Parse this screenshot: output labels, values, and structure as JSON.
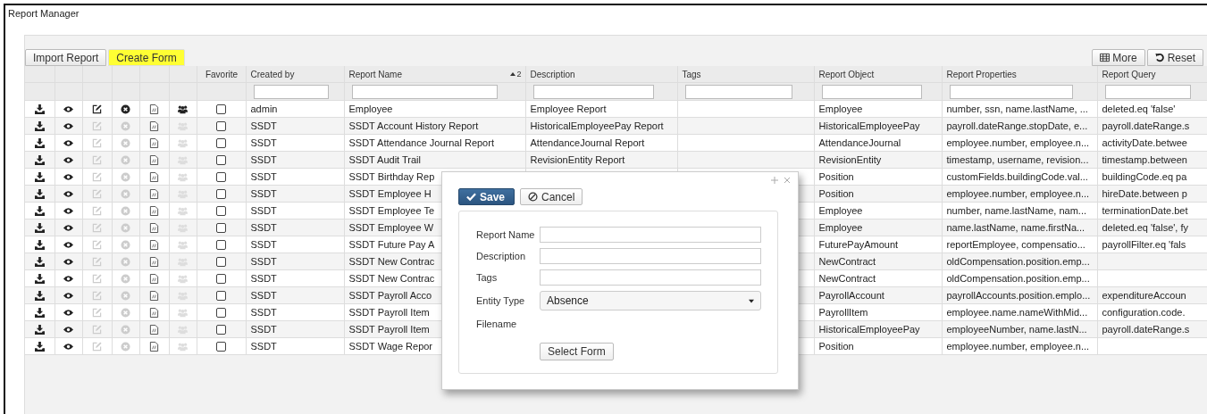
{
  "window": {
    "title": "Report Manager"
  },
  "toolbar": {
    "buttons": [
      {
        "label": "Import Report",
        "highlighted": false
      },
      {
        "label": "Create Form",
        "highlighted": true
      }
    ],
    "right_buttons": [
      {
        "label": "More",
        "kind": "grid"
      },
      {
        "label": "Reset",
        "kind": "undo"
      }
    ]
  },
  "columns": [
    {
      "label": "Favorite",
      "filter": false
    },
    {
      "label": "Created by",
      "filter": true
    },
    {
      "label": "Report Name",
      "filter": true,
      "sort_order": "2"
    },
    {
      "label": "Description",
      "filter": true
    },
    {
      "label": "Tags",
      "filter": true
    },
    {
      "label": "Report Object",
      "filter": true
    },
    {
      "label": "Report Properties",
      "filter": true
    },
    {
      "label": "Report Query",
      "filter": true
    }
  ],
  "rows": [
    {
      "editable": true,
      "favorite": false,
      "created_by": "admin",
      "report_name": "Employee",
      "description": "Employee Report",
      "report_object": "Employee",
      "report_properties": "number, ssn, name.lastName, ...",
      "report_query": "deleted.eq 'false'"
    },
    {
      "editable": false,
      "favorite": false,
      "created_by": "SSDT",
      "report_name": "SSDT Account History Report",
      "description": "HistoricalEmployeePay Report",
      "report_object": "HistoricalEmployeePay",
      "report_properties": "payroll.dateRange.stopDate, e...",
      "report_query": "payroll.dateRange.s"
    },
    {
      "editable": false,
      "favorite": false,
      "created_by": "SSDT",
      "report_name": "SSDT Attendance Journal Report",
      "description": "AttendanceJournal Report",
      "report_object": "AttendanceJournal",
      "report_properties": "employee.number, employee.n...",
      "report_query": "activityDate.betwee"
    },
    {
      "editable": false,
      "favorite": false,
      "created_by": "SSDT",
      "report_name": "SSDT Audit Trail",
      "description": "RevisionEntity Report",
      "report_object": "RevisionEntity",
      "report_properties": "timestamp, username, revision...",
      "report_query": "timestamp.between"
    },
    {
      "editable": false,
      "favorite": false,
      "created_by": "SSDT",
      "report_name": "SSDT Birthday Rep",
      "report_object": "Position",
      "report_properties": "customFields.buildingCode.val...",
      "report_query": "buildingCode.eq pa"
    },
    {
      "editable": false,
      "favorite": false,
      "created_by": "SSDT",
      "report_name": "SSDT Employee H",
      "report_object": "Position",
      "report_properties": "employee.number, employee.n...",
      "report_query": "hireDate.between p"
    },
    {
      "editable": false,
      "favorite": false,
      "created_by": "SSDT",
      "report_name": "SSDT Employee Te",
      "report_object": "Employee",
      "report_properties": "number, name.lastName, nam...",
      "report_query": "terminationDate.bet"
    },
    {
      "editable": false,
      "favorite": false,
      "created_by": "SSDT",
      "report_name": "SSDT Employee W",
      "report_object": "Employee",
      "report_properties": "name.lastName, name.firstNa...",
      "report_query": "deleted.eq 'false', fy"
    },
    {
      "editable": false,
      "favorite": false,
      "created_by": "SSDT",
      "report_name": "SSDT Future Pay A",
      "report_object": "FuturePayAmount",
      "report_properties": "reportEmployee, compensatio...",
      "report_query": "payrollFilter.eq 'fals"
    },
    {
      "editable": false,
      "favorite": false,
      "created_by": "SSDT",
      "report_name": "SSDT New Contrac",
      "report_object": "NewContract",
      "report_properties": "oldCompensation.position.emp..."
    },
    {
      "editable": false,
      "favorite": false,
      "created_by": "SSDT",
      "report_name": "SSDT New Contrac",
      "report_object": "NewContract",
      "report_properties": "oldCompensation.position.emp..."
    },
    {
      "editable": false,
      "favorite": false,
      "created_by": "SSDT",
      "report_name": "SSDT Payroll Acco",
      "report_object": "PayrollAccount",
      "report_properties": "payrollAccounts.position.emplo...",
      "report_query": "expenditureAccoun"
    },
    {
      "editable": false,
      "favorite": false,
      "created_by": "SSDT",
      "report_name": "SSDT Payroll Item",
      "report_object": "PayrollItem",
      "report_properties": "employee.name.nameWithMid...",
      "report_query": "configuration.code."
    },
    {
      "editable": false,
      "favorite": false,
      "created_by": "SSDT",
      "report_name": "SSDT Payroll Item",
      "report_object": "HistoricalEmployeePay",
      "report_properties": "employeeNumber, name.lastN...",
      "report_query": "payroll.dateRange.s"
    },
    {
      "editable": false,
      "favorite": false,
      "created_by": "SSDT",
      "report_name": "SSDT Wage Repor",
      "report_object": "Position",
      "report_properties": "employee.number, employee.n..."
    }
  ],
  "dialog": {
    "buttons": [
      {
        "label": "Save",
        "kind": "primary"
      },
      {
        "label": "Cancel",
        "kind": "cancel"
      }
    ],
    "fields": [
      {
        "label": "Report Name",
        "kind": "text"
      },
      {
        "label": "Description",
        "kind": "text"
      },
      {
        "label": "Tags",
        "kind": "text"
      },
      {
        "label": "Entity Type",
        "kind": "select",
        "value": "Absence"
      },
      {
        "label": "Filename",
        "kind": "file",
        "button": "Select Form"
      }
    ]
  }
}
